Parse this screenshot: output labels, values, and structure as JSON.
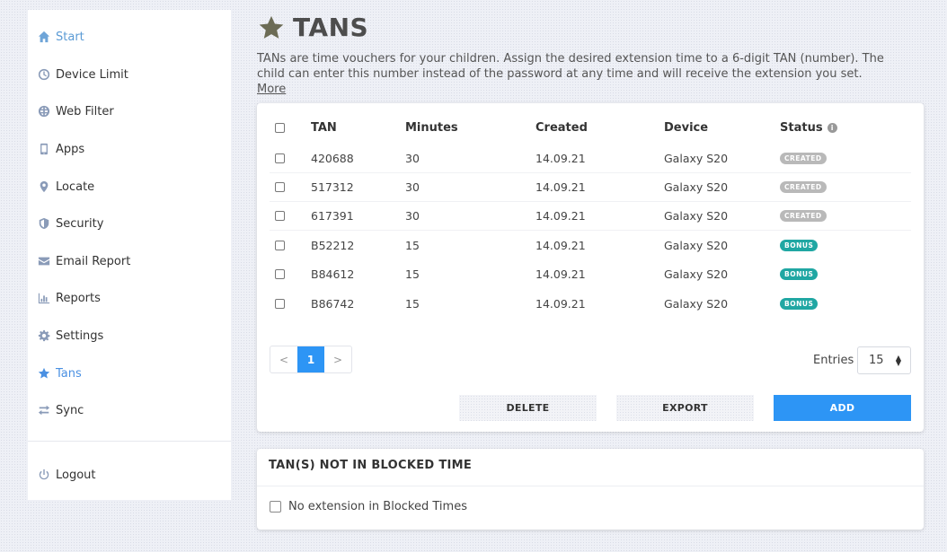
{
  "sidebar": {
    "items": [
      {
        "label": "Start",
        "icon": "home-icon"
      },
      {
        "label": "Device Limit",
        "icon": "clock-icon"
      },
      {
        "label": "Web Filter",
        "icon": "globe-icon"
      },
      {
        "label": "Apps",
        "icon": "phone-icon"
      },
      {
        "label": "Locate",
        "icon": "map-pin-icon"
      },
      {
        "label": "Security",
        "icon": "shield-icon"
      },
      {
        "label": "Email Report",
        "icon": "envelope-icon"
      },
      {
        "label": "Reports",
        "icon": "bar-chart-icon"
      },
      {
        "label": "Settings",
        "icon": "gear-icon"
      },
      {
        "label": "Tans",
        "icon": "star-icon",
        "active": true
      },
      {
        "label": "Sync",
        "icon": "sync-arrows-icon"
      }
    ],
    "logout": {
      "label": "Logout",
      "icon": "power-icon"
    }
  },
  "header": {
    "title": "TANS",
    "intro": "TANs are time vouchers for your children. Assign the desired extension time to a 6-digit TAN (number). The child can enter this number instead of the password at any time and will receive the extension you set.",
    "more_link": "More"
  },
  "table": {
    "columns": {
      "tan": "TAN",
      "minutes": "Minutes",
      "created": "Created",
      "device": "Device",
      "status": "Status"
    },
    "rows": [
      {
        "tan": "420688",
        "minutes": "30",
        "created": "14.09.21",
        "device": "Galaxy S20",
        "status": "CREATED"
      },
      {
        "tan": "517312",
        "minutes": "30",
        "created": "14.09.21",
        "device": "Galaxy S20",
        "status": "CREATED"
      },
      {
        "tan": "617391",
        "minutes": "30",
        "created": "14.09.21",
        "device": "Galaxy S20",
        "status": "CREATED"
      },
      {
        "tan": "B52212",
        "minutes": "15",
        "created": "14.09.21",
        "device": "Galaxy S20",
        "status": "BONUS"
      },
      {
        "tan": "B84612",
        "minutes": "15",
        "created": "14.09.21",
        "device": "Galaxy S20",
        "status": "BONUS"
      },
      {
        "tan": "B86742",
        "minutes": "15",
        "created": "14.09.21",
        "device": "Galaxy S20",
        "status": "BONUS"
      }
    ]
  },
  "pagination": {
    "prev": "<",
    "current": "1",
    "next": ">"
  },
  "entries": {
    "label": "Entries",
    "value": "15"
  },
  "actions": {
    "delete": "DELETE",
    "export": "EXPORT",
    "add": "ADD"
  },
  "blocked": {
    "title": "TAN(S) NOT IN BLOCKED TIME",
    "option_label": "No extension in Blocked Times"
  },
  "colors": {
    "accent": "#2d95f5",
    "bonus": "#20a7a3",
    "created": "#b9b9b9"
  }
}
